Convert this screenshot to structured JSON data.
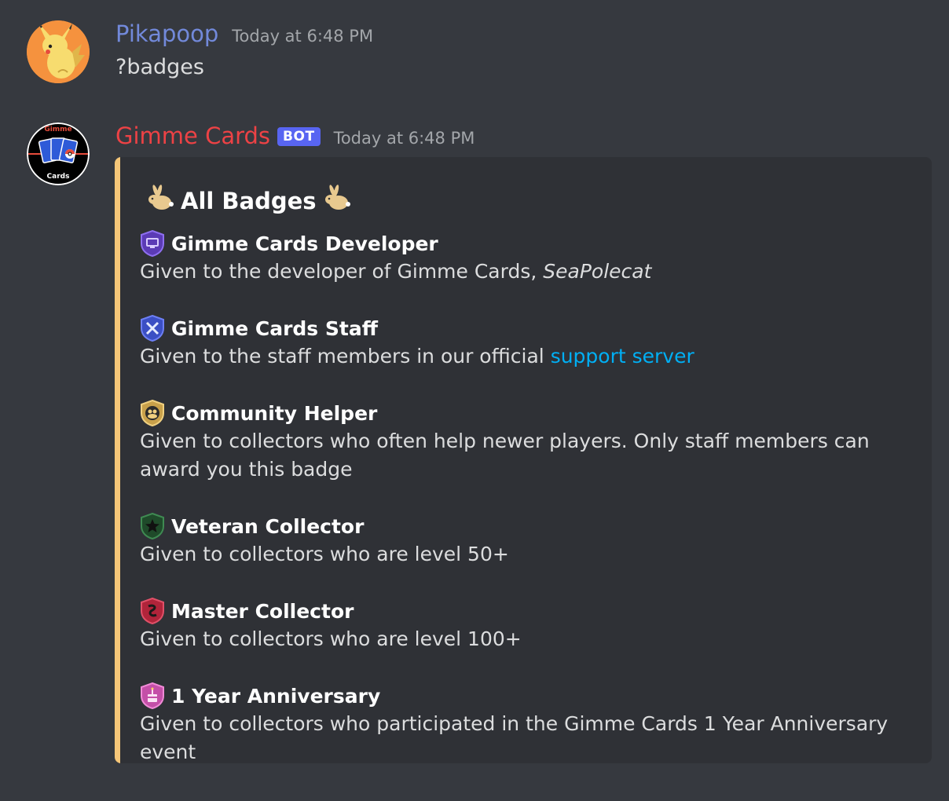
{
  "messages": [
    {
      "username": "Pikapoop",
      "timestamp": "Today at 6:48 PM",
      "content": "?badges",
      "name_color": "#7289da"
    },
    {
      "username": "Gimme Cards",
      "bot_tag": "BOT",
      "timestamp": "Today at 6:48 PM",
      "name_color": "#ed4245",
      "avatar_text_top": "Gimme",
      "avatar_text_bottom": "Cards"
    }
  ],
  "embed": {
    "accent_color": "#f5c678",
    "title": "All Badges",
    "fields": [
      {
        "name": "Gimme Cards Developer",
        "icon": "developer-badge-icon",
        "value": "Given to the developer of Gimme Cards, ",
        "value_italic": "SeaPolecat"
      },
      {
        "name": "Gimme Cards Staff",
        "icon": "staff-badge-icon",
        "value": "Given to the staff members in our official ",
        "value_link": "support server"
      },
      {
        "name": "Community Helper",
        "icon": "helper-badge-icon",
        "value": "Given to collectors who often help newer players. Only staff members can award you this badge"
      },
      {
        "name": "Veteran Collector",
        "icon": "veteran-badge-icon",
        "value": "Given to collectors who are level 50+"
      },
      {
        "name": "Master Collector",
        "icon": "master-badge-icon",
        "value": "Given to collectors who are level 100+"
      },
      {
        "name": "1 Year Anniversary",
        "icon": "anniversary-badge-icon",
        "value": "Given to collectors who participated in the Gimme Cards 1 Year Anniversary event"
      }
    ]
  }
}
